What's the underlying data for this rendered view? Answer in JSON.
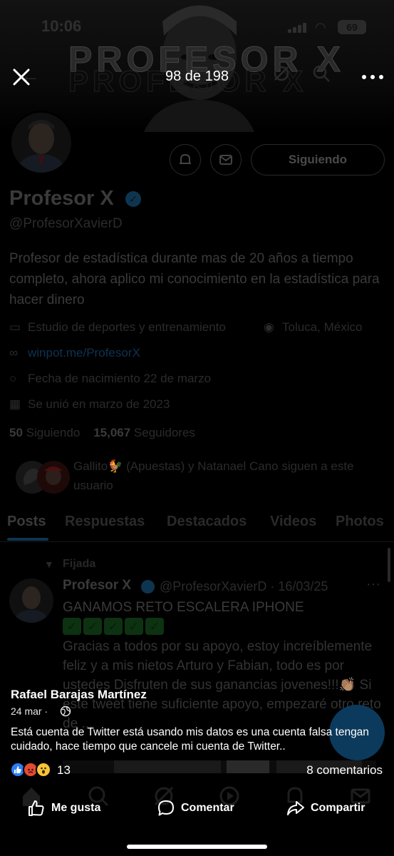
{
  "status_bar": {
    "time": "10:06",
    "battery": "69"
  },
  "viewer": {
    "counter": "98 de 198",
    "close_icon": "close-icon",
    "more_icon": "more-horizontal-icon"
  },
  "profile": {
    "banner_text": "PROFESOR X",
    "name": "Profesor X",
    "handle": "@ProfesorXavierD",
    "follow_button": "Siguiendo",
    "bio": "Profesor de estadística durante mas de 20 años a tiempo completo, ahora aplico mi conocimiento en la estadística para hacer dinero",
    "category": "Estudio de deportes y entrenamiento",
    "location": "Toluca, México",
    "website": "winpot.me/ProfesorX",
    "birthday": "Fecha de nacimiento 22 de marzo",
    "joined": "Se unió en marzo de 2023",
    "following_count": "50",
    "following_label": "Siguiendo",
    "followers_count": "15,067",
    "followers_label": "Seguidores",
    "followed_by": "Gallito🐓 (Apuestas) y Natanael Cano siguen a este usuario"
  },
  "tabs": [
    {
      "label": "Posts"
    },
    {
      "label": "Respuestas"
    },
    {
      "label": "Destacados"
    },
    {
      "label": "Videos"
    },
    {
      "label": "Photos"
    }
  ],
  "tweet": {
    "pinned_label": "Fijada",
    "name": "Profesor X",
    "meta": "@ProfesorXavierD · 16/03/25",
    "line1": "GANAMOS RETO ESCALERA IPHONE",
    "checks": [
      "✓",
      "✓",
      "✓",
      "✓",
      "✓"
    ],
    "body": "Gracias a todos por su apoyo, estoy increíblemente feliz y a mis nietos Arturo y Fabian, todo es por ustedes Disfruten de sus ganancias jovenes!!!👏🏽 Si este tweet tiene suficiente apoyo, empezaré otro reto de ..."
  },
  "caption": {
    "author": "Rafael Barajas Martínez",
    "date": "24 mar",
    "separator": "·",
    "text": "Está cuenta de Twitter está usando mis datos es una cuenta falsa tengan cuidado, hace tiempo que cancele mi cuenta de Twitter..",
    "reaction_count": "13",
    "comments": "8 comentarios",
    "actions": {
      "like": "Me gusta",
      "comment": "Comentar",
      "share": "Compartir"
    }
  },
  "colors": {
    "twitter_blue": "#1d9bf0",
    "fb_like": "#2d7cf5",
    "fb_angry": "#e24b33",
    "fb_wow": "#f7c33a"
  }
}
